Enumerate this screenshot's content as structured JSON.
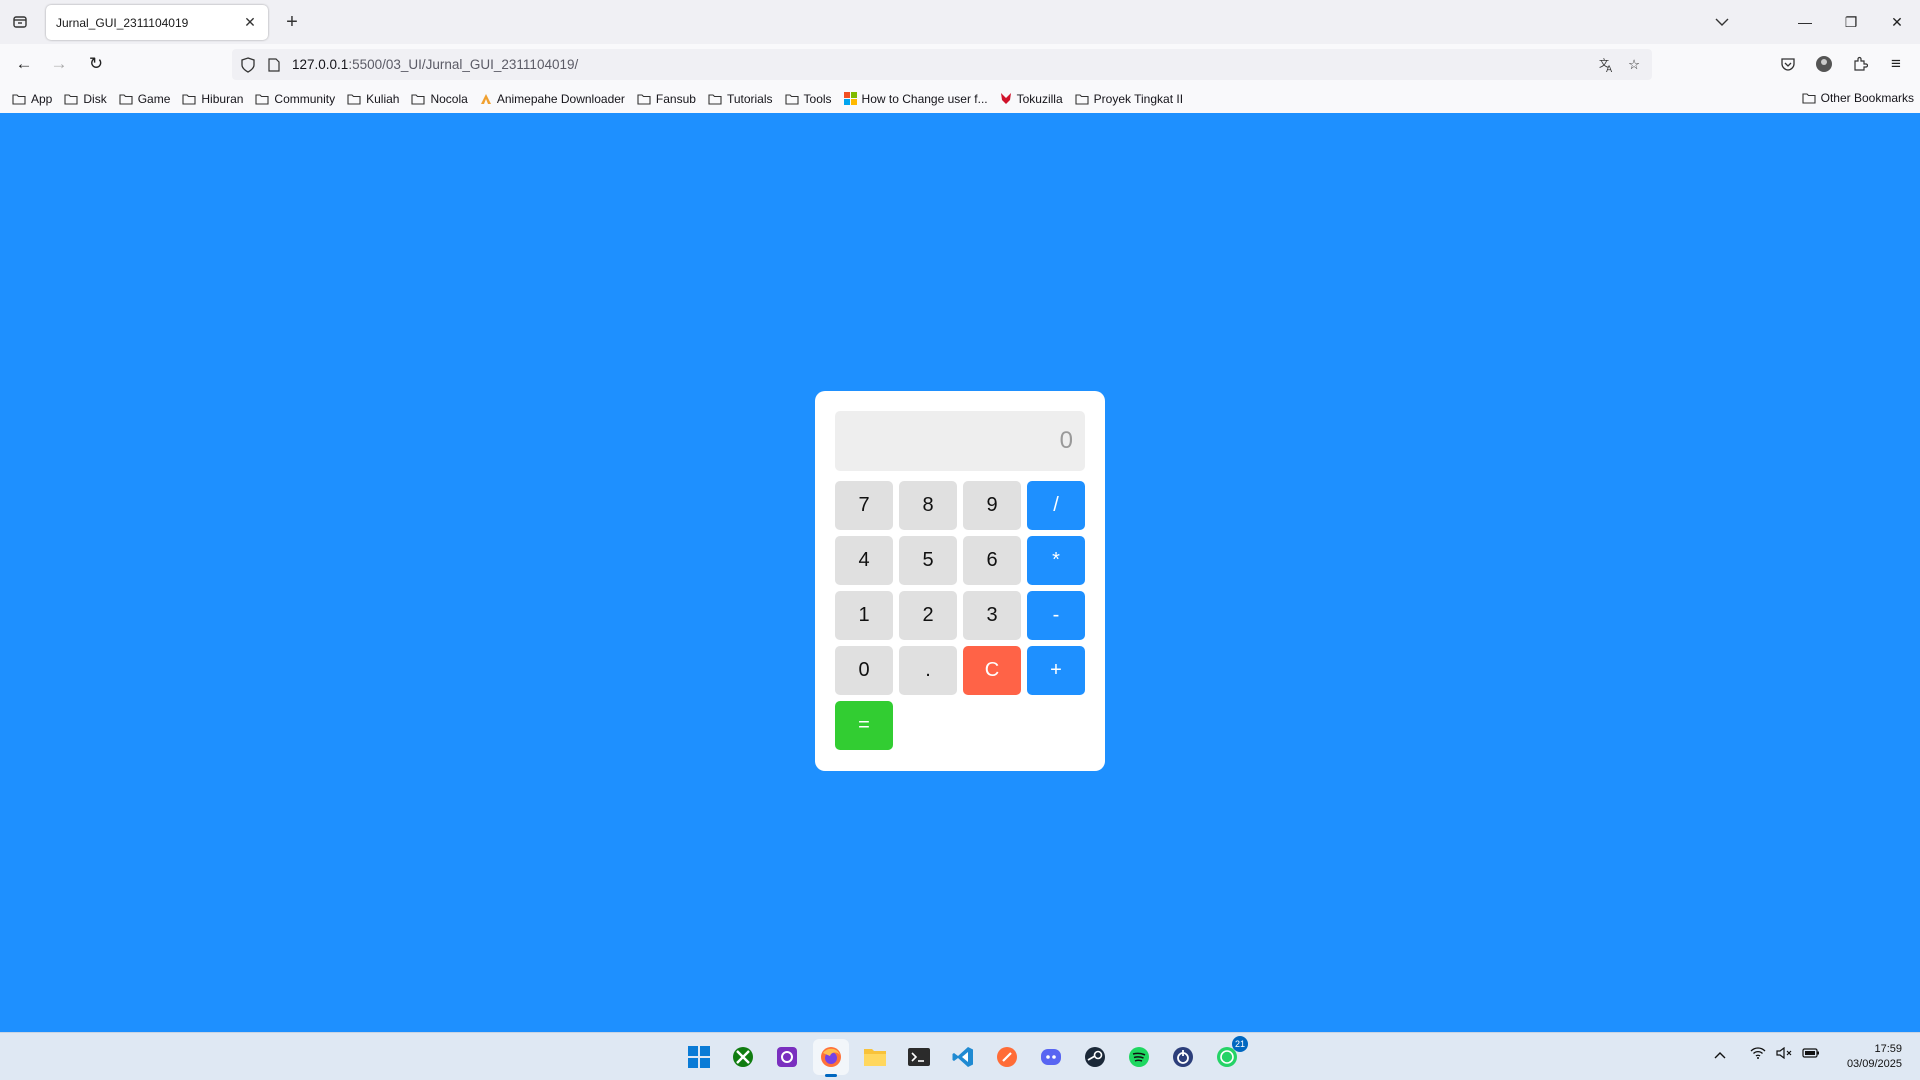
{
  "browser": {
    "tab_title": "Jurnal_GUI_2311104019",
    "url_host": "127.0.0.1",
    "url_path": ":5500/03_UI/Jurnal_GUI_2311104019/",
    "bookmarks": [
      "App",
      "Disk",
      "Game",
      "Hiburan",
      "Community",
      "Kuliah",
      "Nocola",
      "Animepahe Downloader",
      "Fansub",
      "Tutorials",
      "Tools",
      "How to Change user f...",
      "Tokuzilla",
      "Proyek Tingkat II"
    ],
    "other_bookmarks": "Other Bookmarks"
  },
  "calculator": {
    "display_value": "0",
    "keys": [
      {
        "label": "7",
        "kind": "digit"
      },
      {
        "label": "8",
        "kind": "digit"
      },
      {
        "label": "9",
        "kind": "digit"
      },
      {
        "label": "/",
        "kind": "op"
      },
      {
        "label": "4",
        "kind": "digit"
      },
      {
        "label": "5",
        "kind": "digit"
      },
      {
        "label": "6",
        "kind": "digit"
      },
      {
        "label": "*",
        "kind": "op"
      },
      {
        "label": "1",
        "kind": "digit"
      },
      {
        "label": "2",
        "kind": "digit"
      },
      {
        "label": "3",
        "kind": "digit"
      },
      {
        "label": "-",
        "kind": "op"
      },
      {
        "label": "0",
        "kind": "digit"
      },
      {
        "label": ".",
        "kind": "digit"
      },
      {
        "label": "C",
        "kind": "clear"
      },
      {
        "label": "+",
        "kind": "op"
      },
      {
        "label": "=",
        "kind": "equals"
      }
    ],
    "colors": {
      "page_bg": "#1e90ff",
      "operator": "#1e90ff",
      "clear": "#ff6347",
      "equals": "#32cd32",
      "digit": "#e0e0e0"
    }
  },
  "taskbar": {
    "apps": [
      "start-icon",
      "xbox-icon",
      "screen-recorder-icon",
      "firefox-icon",
      "file-explorer-icon",
      "terminal-icon",
      "vscode-icon",
      "postman-icon",
      "discord-icon",
      "steam-icon",
      "spotify-icon",
      "power-icon",
      "whatsapp-icon"
    ],
    "whatsapp_badge": "21",
    "time": "17:59",
    "date": "03/09/2025"
  }
}
